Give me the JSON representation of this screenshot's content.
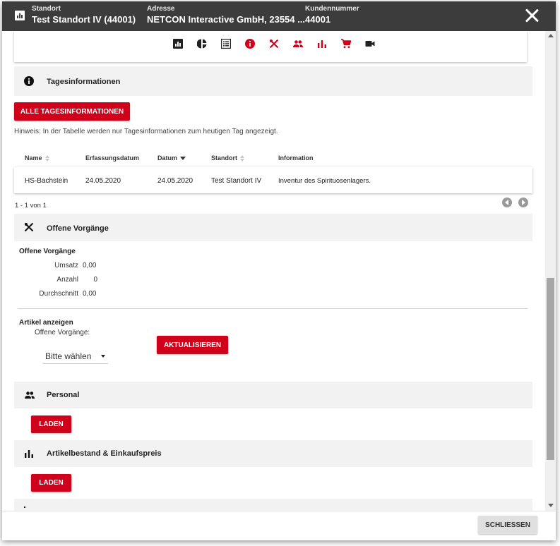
{
  "header": {
    "standort_caption": "Standort",
    "standort_value": "Test Standort IV (44001)",
    "adresse_caption": "Adresse",
    "adresse_value": "NETCON Interactive GmbH, 23554 ...",
    "kunden_caption": "Kundennummer",
    "kunden_value": "44001"
  },
  "iconbar": [
    "report-icon",
    "pie-chart-icon",
    "list-icon",
    "info-icon",
    "cutlery-icon",
    "people-icon",
    "bar-chart-icon",
    "cart-icon",
    "video-icon"
  ],
  "colors": {
    "accent": "#d0021b",
    "header_bg": "#3c3c3c",
    "section_bg": "#f2f2f2"
  },
  "tagesinfo": {
    "title": "Tagesinformationen",
    "button": "ALLE TAGESINFORMATIONEN",
    "hint": "Hinweis: In der Tabelle werden nur Tagesinformationen zum heutigen Tag angezeigt.",
    "columns": [
      "Name",
      "Erfassungsdatum",
      "Datum",
      "Standort",
      "Information"
    ],
    "rows": [
      [
        "HS-Bachstein",
        "24.05.2020",
        "24.05.2020",
        "Test Standort IV",
        "Inventur des Spirituosenlagers."
      ]
    ],
    "pagination": "1 - 1 von 1"
  },
  "vorgaenge": {
    "title": "Offene Vorgänge",
    "subtitle": "Offene Vorgänge",
    "stats": [
      {
        "label": "Umsatz",
        "value": "0,00"
      },
      {
        "label": "Anzahl",
        "value": "0"
      },
      {
        "label": "Durchschnitt",
        "value": "0,00"
      }
    ],
    "artikel_title": "Artikel anzeigen",
    "artikel_label": "Offene Vorgänge:",
    "select_value": "Bitte wählen",
    "refresh_button": "AKTUALISIEREN"
  },
  "personal": {
    "title": "Personal",
    "button": "LADEN"
  },
  "artikelbestand": {
    "title": "Artikelbestand & Einkaufspreis",
    "button": "LADEN"
  },
  "footer": {
    "close_button": "SCHLIESSEN"
  }
}
